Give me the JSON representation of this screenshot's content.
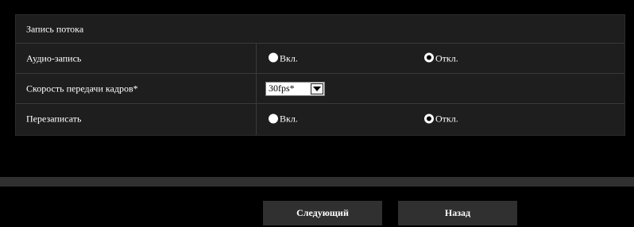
{
  "section": {
    "title": "Запись потока"
  },
  "rows": [
    {
      "label": "Аудио-запись",
      "options": [
        {
          "label": "Вкл.",
          "selected": false
        },
        {
          "label": "Откл.",
          "selected": true
        }
      ]
    },
    {
      "label": "Скорость передачи кадров*",
      "select_value": "30fps*"
    },
    {
      "label": "Перезаписать",
      "options": [
        {
          "label": "Вкл.",
          "selected": false
        },
        {
          "label": "Откл.",
          "selected": true
        }
      ]
    }
  ],
  "buttons": {
    "next_label": "Следующий",
    "back_label": "Назад"
  },
  "colors": {
    "background": "#000000",
    "panel": "#1e1e1e",
    "button": "#303030",
    "text": "#ffffff"
  }
}
